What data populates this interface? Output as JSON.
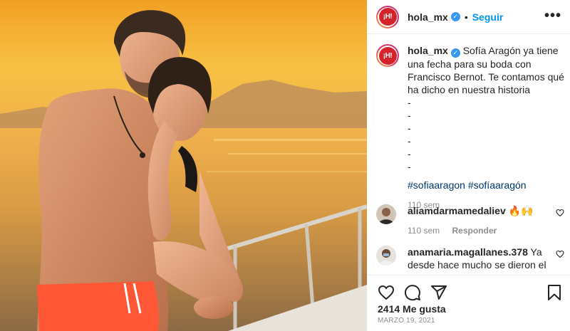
{
  "post": {
    "username": "hola_mx",
    "logo_text": "¡H!",
    "follow_label": "Seguir",
    "more_label": "•••",
    "dot": "•",
    "verified_mark": "✓"
  },
  "caption": {
    "username": "hola_mx",
    "text": "Sofía Aragón ya tiene una fecha para su boda con Francisco Bernot. Te contamos qué ha dicho en nuestra historia",
    "dashes": [
      "-",
      "-",
      "-",
      "-",
      "-",
      "-"
    ],
    "hashtags": "#sofiaaragon #sofíaaragón",
    "time": "110 sem"
  },
  "comments": [
    {
      "username": "aliamdarmamedaliev",
      "text": "🔥🙌",
      "time": "110 sem",
      "reply_label": "Responder"
    },
    {
      "username": "anamaria.magallanes.378",
      "text": "Ya desde hace mucho se dieron el sii",
      "emoji": "😍😍😍😍"
    }
  ],
  "footer": {
    "likes": "2414 Me gusta",
    "date": "MARZO 19, 2021"
  },
  "icons": {
    "like": "heart-icon",
    "comment": "comment-icon",
    "share": "share-icon",
    "save": "bookmark-icon",
    "more": "more-icon",
    "verified": "verified-badge-icon"
  },
  "colors": {
    "accent": "#0095f6",
    "hashtag": "#00376b",
    "muted": "#8e8e8e",
    "verified": "#3897f0",
    "brand_red": "#d6232a"
  }
}
